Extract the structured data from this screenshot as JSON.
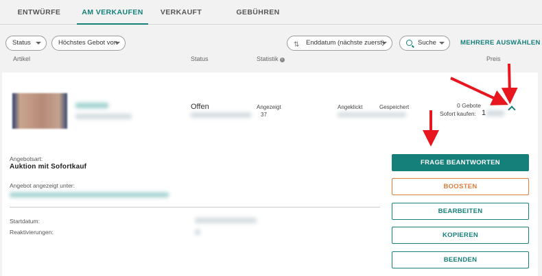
{
  "tabs": [
    {
      "label": "ENTWÜRFE"
    },
    {
      "label": "AM VERKAUFEN",
      "active": true
    },
    {
      "label": "VERKAUFT"
    },
    {
      "label": "GEBÜHREN"
    }
  ],
  "filters": {
    "status": "Status",
    "bid": "Höchstes Gebot von",
    "sort": "Enddatum (nächste zuerst)",
    "search": "Suche",
    "multi_select": "MEHRERE AUSWÄHLEN"
  },
  "columns": {
    "article": "Artikel",
    "status": "Status",
    "stats": "Statistik",
    "price": "Preis"
  },
  "listing": {
    "status": "Offen",
    "viewed_label": "Angezeigt",
    "viewed_value": "37",
    "clicked_label": "Angeklickt",
    "saved_label": "Gespeichert",
    "bids": "0 Gebote",
    "buy_now_label": "Sofort kaufen:",
    "buy_now_value": "1"
  },
  "details": {
    "offer_type_label": "Angebotsart:",
    "offer_type_value": "Auktion mit Sofortkauf",
    "shown_under_label": "Angebot angezeigt unter:",
    "start_date_label": "Startdatum:",
    "reactivations_label": "Reaktivierungen:"
  },
  "actions": {
    "answer": "FRAGE BEANTWORTEN",
    "boost": "BOOSTEN",
    "edit": "BEARBEITEN",
    "copy": "KOPIEREN",
    "end": "BEENDEN"
  },
  "colors": {
    "accent": "#157f7a",
    "boost": "#e07b39",
    "annotation_arrow": "#e8171f"
  }
}
